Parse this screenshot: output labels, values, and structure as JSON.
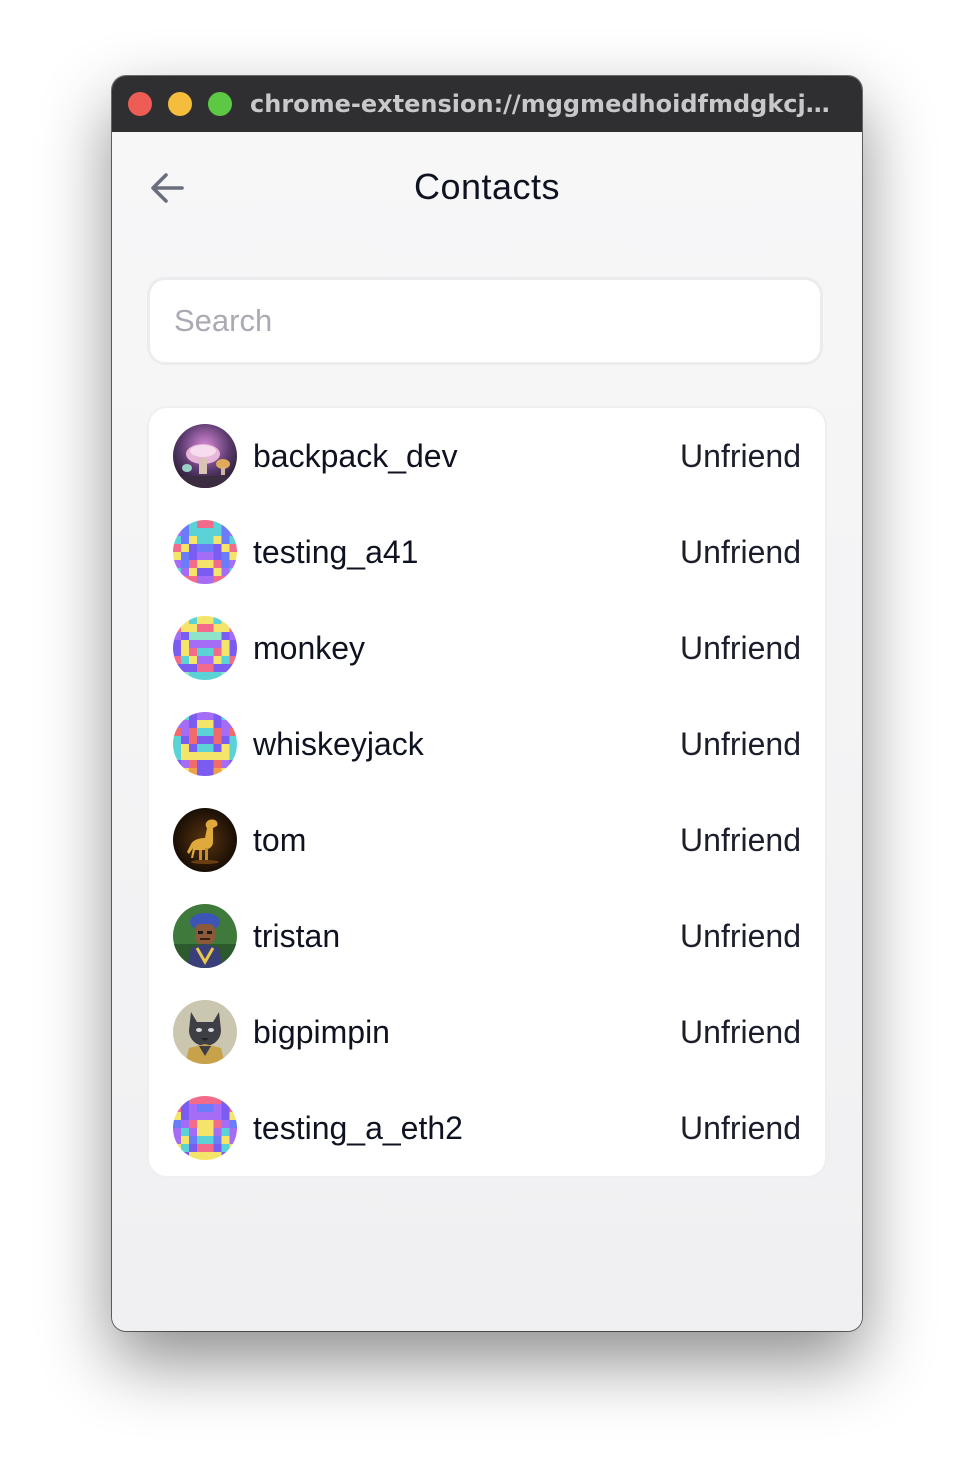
{
  "window": {
    "url": "chrome-extension://mggmedhoidfmdgkcjeja..."
  },
  "header": {
    "title": "Contacts",
    "back_icon": "arrow-left-icon"
  },
  "search": {
    "placeholder": "Search",
    "value": ""
  },
  "contacts": [
    {
      "username": "backpack_dev",
      "action": "Unfriend",
      "avatar": "mushroom-art"
    },
    {
      "username": "testing_a41",
      "action": "Unfriend",
      "avatar": "pixel-identicon"
    },
    {
      "username": "monkey",
      "action": "Unfriend",
      "avatar": "pixel-identicon"
    },
    {
      "username": "whiskeyjack",
      "action": "Unfriend",
      "avatar": "pixel-identicon"
    },
    {
      "username": "tom",
      "action": "Unfriend",
      "avatar": "golden-dinosaur"
    },
    {
      "username": "tristan",
      "action": "Unfriend",
      "avatar": "character-portrait"
    },
    {
      "username": "bigpimpin",
      "action": "Unfriend",
      "avatar": "cat-portrait"
    },
    {
      "username": "testing_a_eth2",
      "action": "Unfriend",
      "avatar": "pixel-identicon"
    }
  ],
  "colors": {
    "titlebar": "#2f2f31",
    "background": "#f3f3f5",
    "card": "#ffffff",
    "text": "#0f1220",
    "placeholder": "#a9aab3"
  }
}
